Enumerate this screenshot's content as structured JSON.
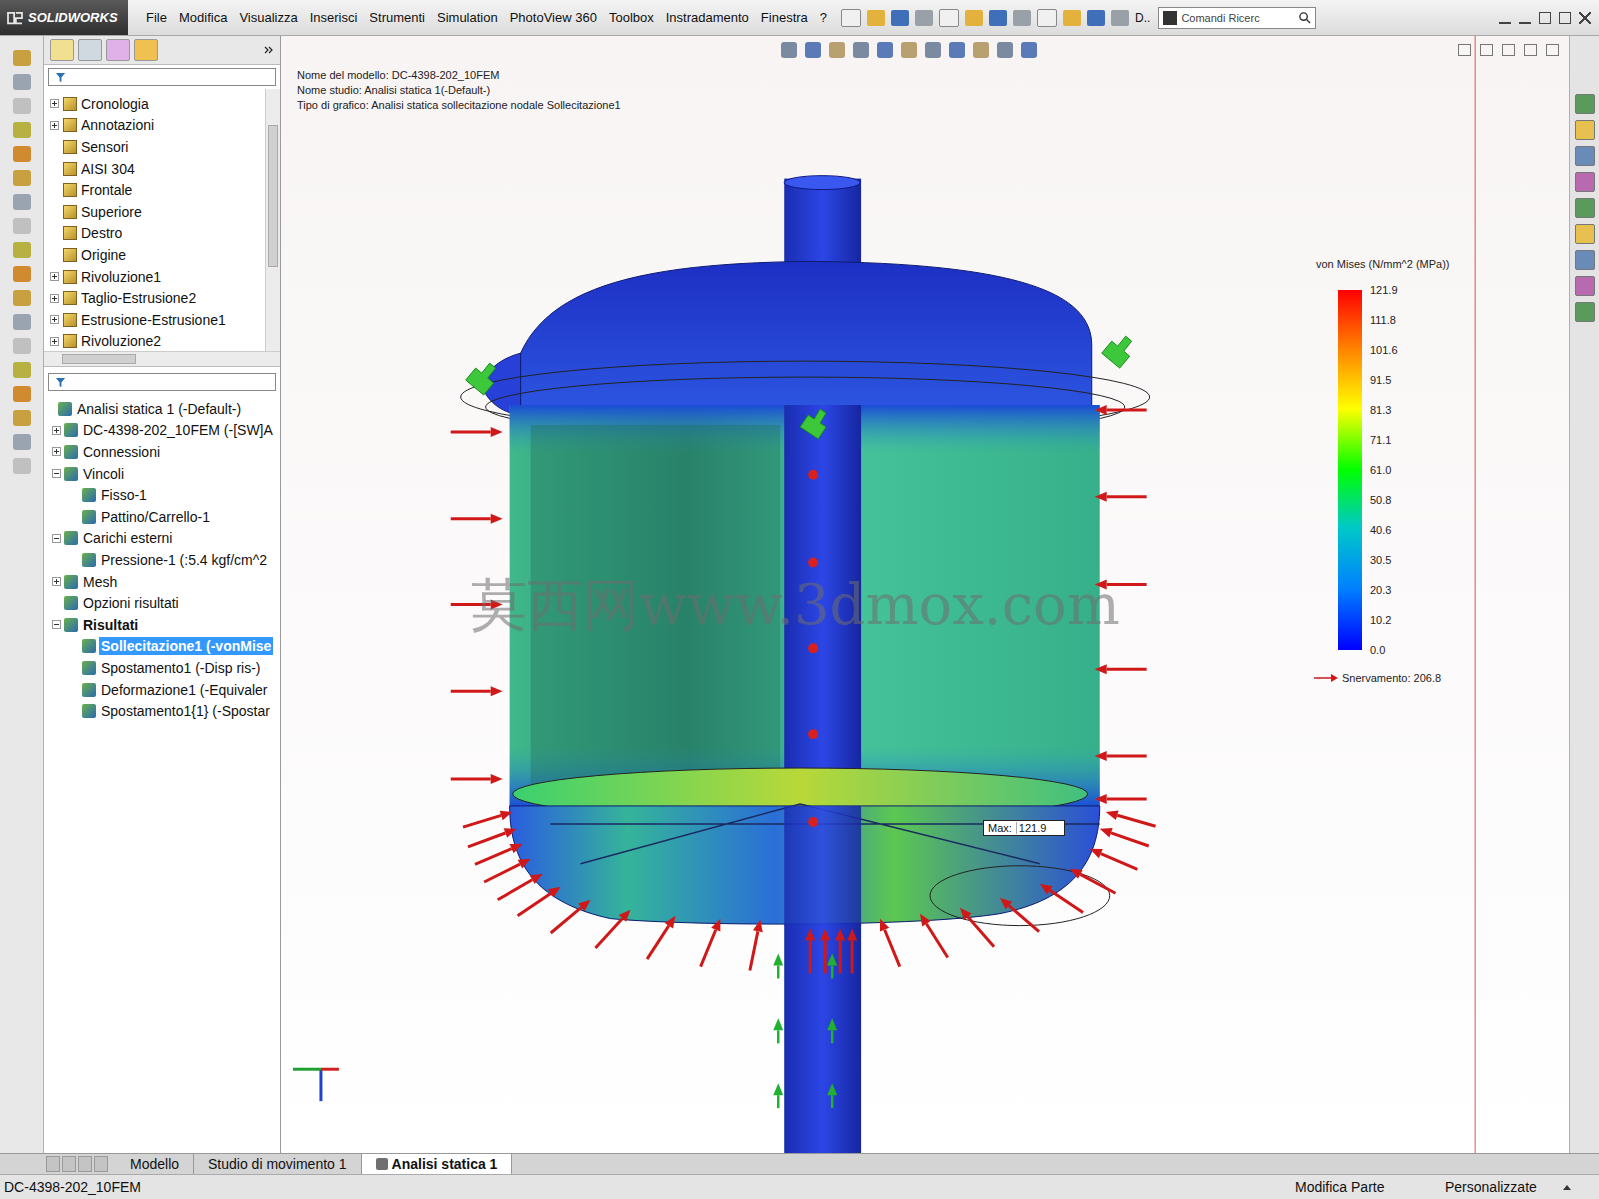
{
  "app": {
    "logo": "SOLIDWORKS"
  },
  "menu": [
    "File",
    "Modifica",
    "Visualizza",
    "Inserisci",
    "Strumenti",
    "Simulation",
    "PhotoView 360",
    "Toolbox",
    "Instradamento",
    "Finestra",
    "?"
  ],
  "toolbar": {
    "label": "D..",
    "search_placeholder": "Comandi Ricerc"
  },
  "feature_tree": {
    "items": [
      {
        "label": "Cronologia",
        "expandable": true
      },
      {
        "label": "Annotazioni",
        "expandable": true
      },
      {
        "label": "Sensori",
        "expandable": false
      },
      {
        "label": "AISI 304",
        "expandable": false
      },
      {
        "label": "Frontale",
        "expandable": false
      },
      {
        "label": "Superiore",
        "expandable": false
      },
      {
        "label": "Destro",
        "expandable": false
      },
      {
        "label": "Origine",
        "expandable": false
      },
      {
        "label": "Rivoluzione1",
        "expandable": true
      },
      {
        "label": "Taglio-Estrusione2",
        "expandable": true
      },
      {
        "label": "Estrusione-Estrusione1",
        "expandable": true
      },
      {
        "label": "Rivoluzione2",
        "expandable": true
      }
    ]
  },
  "study_tree": {
    "items": [
      {
        "label": "Analisi statica 1 (-Default-)",
        "depth": 0,
        "expandable": false,
        "expanded": false,
        "selected": false,
        "bold": false
      },
      {
        "label": "DC-4398-202_10FEM (-[SW]A",
        "depth": 1,
        "expandable": true,
        "expanded": false,
        "selected": false,
        "bold": false
      },
      {
        "label": "Connessioni",
        "depth": 1,
        "expandable": true,
        "expanded": false,
        "selected": false,
        "bold": false
      },
      {
        "label": "Vincoli",
        "depth": 1,
        "expandable": true,
        "expanded": true,
        "selected": false,
        "bold": false
      },
      {
        "label": "Fisso-1",
        "depth": 2,
        "expandable": false,
        "expanded": false,
        "selected": false,
        "bold": false
      },
      {
        "label": "Pattino/Carrello-1",
        "depth": 2,
        "expandable": false,
        "expanded": false,
        "selected": false,
        "bold": false
      },
      {
        "label": "Carichi esterni",
        "depth": 1,
        "expandable": true,
        "expanded": true,
        "selected": false,
        "bold": false
      },
      {
        "label": "Pressione-1 (:5.4 kgf/cm^2",
        "depth": 2,
        "expandable": false,
        "expanded": false,
        "selected": false,
        "bold": false
      },
      {
        "label": "Mesh",
        "depth": 1,
        "expandable": true,
        "expanded": false,
        "selected": false,
        "bold": false
      },
      {
        "label": "Opzioni risultati",
        "depth": 1,
        "expandable": false,
        "expanded": false,
        "selected": false,
        "bold": false
      },
      {
        "label": "Risultati",
        "depth": 1,
        "expandable": true,
        "expanded": true,
        "selected": false,
        "bold": true
      },
      {
        "label": "Sollecitazione1 (-vonMise",
        "depth": 2,
        "expandable": false,
        "expanded": false,
        "selected": true,
        "bold": true
      },
      {
        "label": "Spostamento1 (-Disp ris-)",
        "depth": 2,
        "expandable": false,
        "expanded": false,
        "selected": false,
        "bold": false
      },
      {
        "label": "Deformazione1 (-Equivaler",
        "depth": 2,
        "expandable": false,
        "expanded": false,
        "selected": false,
        "bold": false
      },
      {
        "label": "Spostamento1{1} (-Spostar",
        "depth": 2,
        "expandable": false,
        "expanded": false,
        "selected": false,
        "bold": false
      }
    ]
  },
  "viewport": {
    "info": [
      "Nome del modello: DC-4398-202_10FEM",
      "Nome studio: Analisi statica 1(-Default-)",
      "Tipo di grafico: Analisi statica sollecitazione nodale Sollecitazione1"
    ],
    "legend": {
      "title": "von Mises (N/mm^2 (MPa))",
      "ticks": [
        "121.9",
        "111.8",
        "101.6",
        "91.5",
        "81.3",
        "71.1",
        "61.0",
        "50.8",
        "40.6",
        "30.5",
        "20.3",
        "10.2",
        "0.0"
      ],
      "yield": "Snervamento: 206.8"
    },
    "max_label": {
      "prefix": "Max:",
      "value": "121.9"
    },
    "watermark": "莫西网www.3dmox.com"
  },
  "tabs": [
    {
      "label": "Modello",
      "selected": false
    },
    {
      "label": "Studio di movimento 1",
      "selected": false
    },
    {
      "label": "Analisi statica 1",
      "selected": true
    }
  ],
  "status_bar": {
    "left": "DC-4398-202_10FEM",
    "center": "Modifica Parte",
    "right": "Personalizzate"
  }
}
